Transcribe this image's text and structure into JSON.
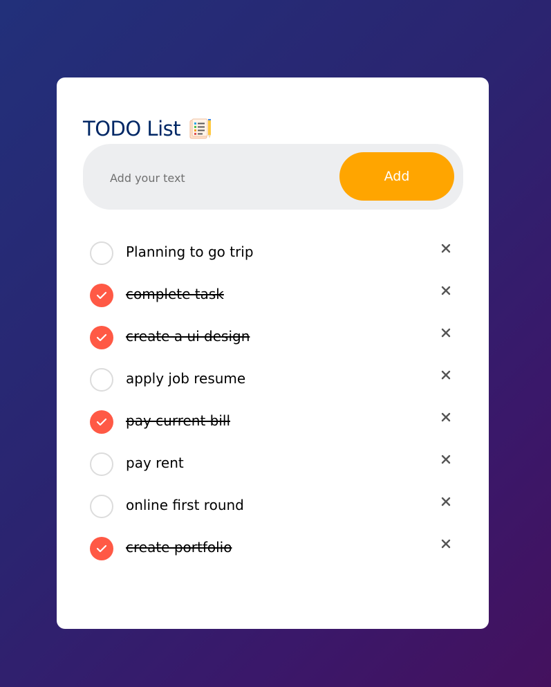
{
  "app": {
    "title": "TODO List",
    "title_icon": "notepad-list-icon"
  },
  "input": {
    "placeholder": "Add your text",
    "value": ""
  },
  "add_button": {
    "label": "Add"
  },
  "colors": {
    "title": "#002765",
    "accent": "#ffa500",
    "checked": "#ff5945",
    "input_bg": "#edeef0"
  },
  "tasks": [
    {
      "text": "Planning to go trip",
      "checked": false
    },
    {
      "text": "complete task",
      "checked": true
    },
    {
      "text": "create a ui design",
      "checked": true
    },
    {
      "text": "apply job resume",
      "checked": false
    },
    {
      "text": "pay current bill",
      "checked": true
    },
    {
      "text": "pay rent",
      "checked": false
    },
    {
      "text": "online first round",
      "checked": false
    },
    {
      "text": "create portfolio",
      "checked": true
    }
  ],
  "remove_icon": "close-icon"
}
